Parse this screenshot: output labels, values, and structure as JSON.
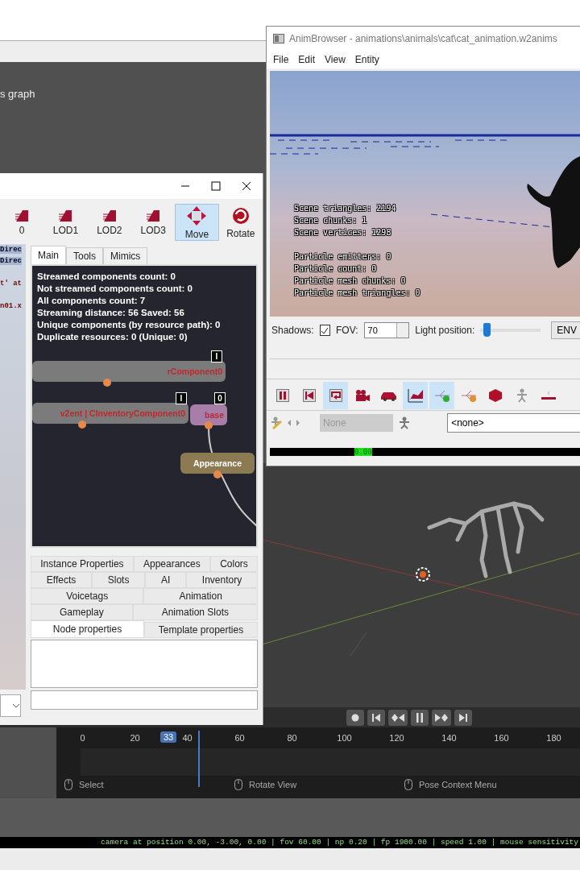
{
  "background": {
    "caption": "s graph"
  },
  "entity_window": {
    "toolbar": [
      {
        "label": "0",
        "kind": "lod",
        "selected": false
      },
      {
        "label": "LOD1",
        "kind": "lod",
        "selected": false
      },
      {
        "label": "LOD2",
        "kind": "lod",
        "selected": false
      },
      {
        "label": "LOD3",
        "kind": "lod",
        "selected": false
      },
      {
        "label": "Move",
        "kind": "move",
        "selected": true
      },
      {
        "label": "Rotate",
        "kind": "rotate",
        "selected": false
      }
    ],
    "viewport_labels": [
      {
        "text": "Direc",
        "kind": "header"
      },
      {
        "text": "Direc",
        "kind": "header"
      },
      {
        "text": "t' at",
        "kind": "error"
      },
      {
        "text": "n01.x",
        "kind": "error"
      }
    ],
    "tabs": [
      {
        "label": "Main",
        "selected": true
      },
      {
        "label": "Tools",
        "selected": false
      },
      {
        "label": "Mimics",
        "selected": false
      }
    ],
    "stats": [
      "Streamed components count: 0",
      "Not streamed components count: 0",
      "All components count: 7",
      "Streaming distance: 56 Saved: 56",
      "Unique components (by resource path): 0",
      "Duplicate resources: 0 (Unique: 0)"
    ],
    "nodes": [
      {
        "label": "rComponent0",
        "kind": "component",
        "badge": "I"
      },
      {
        "label": "v2ent | CInventoryComponent0",
        "kind": "component",
        "badge": "I"
      },
      {
        "label": "base",
        "kind": "base",
        "badge": "0"
      },
      {
        "label": "Appearance",
        "kind": "appearance"
      }
    ],
    "property_tabs": [
      [
        {
          "label": "Instance Properties"
        },
        {
          "label": "Appearances"
        },
        {
          "label": "Colors"
        }
      ],
      [
        {
          "label": "Effects"
        },
        {
          "label": "Slots"
        },
        {
          "label": "AI"
        },
        {
          "label": "Inventory"
        }
      ],
      [
        {
          "label": "Voicetags"
        },
        {
          "label": "Animation"
        }
      ],
      [
        {
          "label": "Gameplay"
        },
        {
          "label": "Animation Slots"
        }
      ]
    ],
    "node_tabs": [
      {
        "label": "Node properties",
        "selected": true
      },
      {
        "label": "Template properties",
        "selected": false
      }
    ]
  },
  "anim_browser": {
    "title": "AnimBrowser - animations\\animals\\cat\\cat_animation.w2anims",
    "menu": [
      "File",
      "Edit",
      "View",
      "Entity"
    ],
    "scene_stats": [
      "Scene triangles: 2194",
      "Scene chunks: 1",
      "Scene vertices: 1298"
    ],
    "particle_stats": [
      "Particle emitters: 0",
      "Particle count: 0",
      "Particle mesh chunks: 0",
      "Particle mesh triangles: 0"
    ],
    "shadows_label": "Shadows:",
    "shadows_checked": true,
    "fov_label": "FOV:",
    "fov_value": "70",
    "light_label": "Light position:",
    "light": {
      "level": 0.05
    },
    "env_button": "ENV",
    "tools": [
      {
        "kind": "pause",
        "selected": false
      },
      {
        "kind": "skip-start",
        "selected": false
      },
      {
        "kind": "loop",
        "selected": true
      },
      {
        "kind": "camera",
        "selected": false
      },
      {
        "kind": "car",
        "selected": false
      },
      {
        "kind": "chart",
        "selected": true
      },
      {
        "kind": "node-add",
        "selected": true
      },
      {
        "kind": "node-remove",
        "selected": false
      },
      {
        "kind": "cube",
        "selected": false
      },
      {
        "kind": "figure",
        "selected": false
      },
      {
        "kind": "line",
        "selected": false
      }
    ],
    "preset": {
      "value": "None",
      "disabled": true
    },
    "name_field": "<none>",
    "time_marker": "0.00"
  },
  "timeline": {
    "frames": [
      "0",
      "20",
      "40",
      "60",
      "80",
      "100",
      "120",
      "140",
      "160",
      "180"
    ],
    "current_frame": "33",
    "controls": [
      {
        "kind": "record"
      },
      {
        "kind": "jump-start"
      },
      {
        "kind": "prev-key"
      },
      {
        "kind": "pause"
      },
      {
        "kind": "next-key"
      },
      {
        "kind": "jump-end"
      }
    ],
    "hints": [
      "Select",
      "Rotate View",
      "Pose Context Menu"
    ]
  },
  "status_bar": "camera at position 0.00, -3.00, 0.00 | fov 60.00 | np 0.20 | fp 1900.00 | speed 1.00 | mouse sensitivity"
}
